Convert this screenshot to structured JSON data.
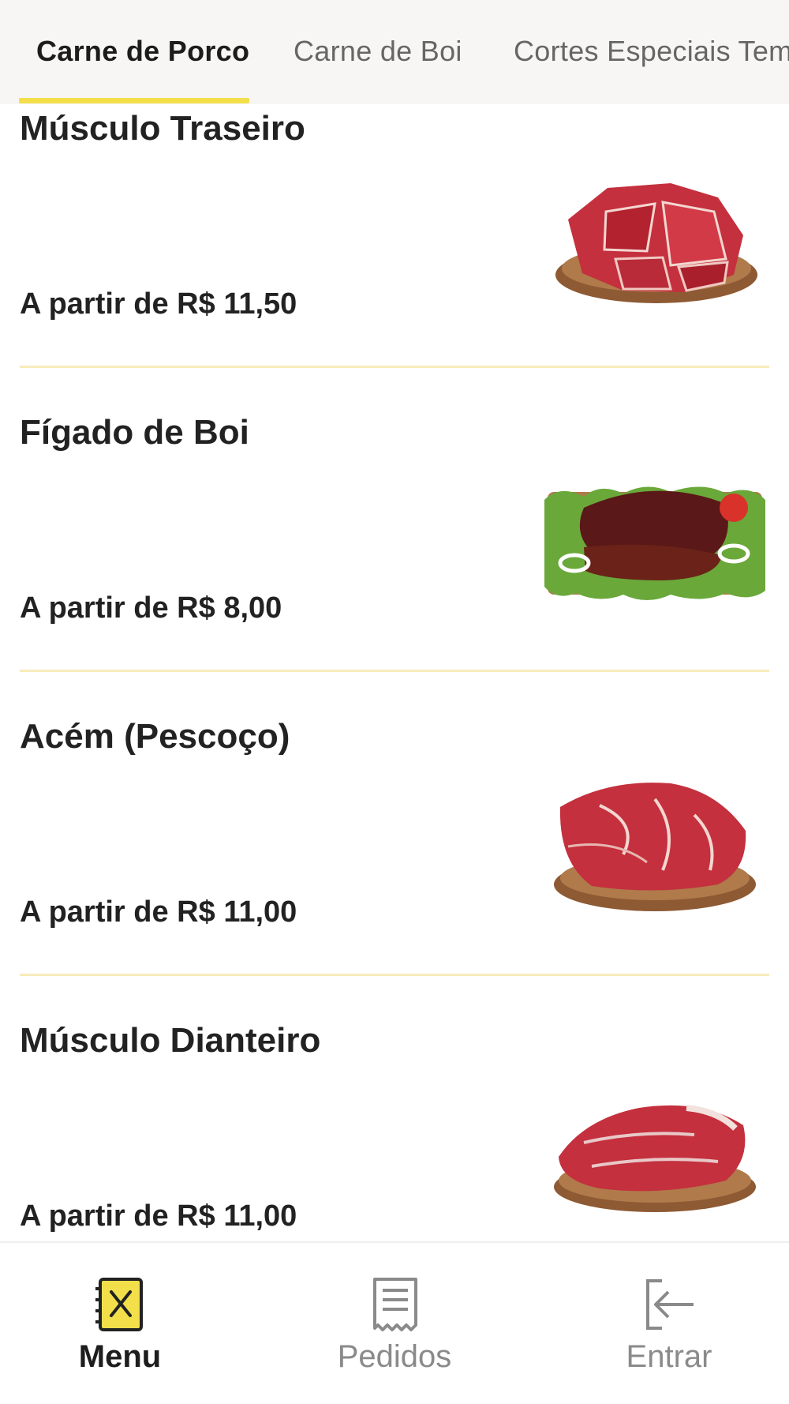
{
  "tabs": [
    {
      "label": "Carne de Porco",
      "active": true
    },
    {
      "label": "Carne de Boi",
      "active": false
    },
    {
      "label": "Cortes Especiais Tem",
      "active": false
    }
  ],
  "products": [
    {
      "name": "Músculo Traseiro",
      "price": "A partir de R$ 11,50",
      "image": "raw-beef-cubes-on-plate"
    },
    {
      "name": "Fígado de Boi",
      "price": "A partir de R$ 8,00",
      "image": "beef-liver-on-board-with-lettuce"
    },
    {
      "name": "Acém (Pescoço)",
      "price": "A partir de R$ 11,00",
      "image": "beef-chuck-on-plate"
    },
    {
      "name": "Músculo Dianteiro",
      "price": "A partir de R$ 11,00",
      "image": "beef-shank-on-plate"
    }
  ],
  "bottom_nav": [
    {
      "label": "Menu",
      "icon": "menu-book-icon",
      "active": true
    },
    {
      "label": "Pedidos",
      "icon": "receipt-icon",
      "active": false
    },
    {
      "label": "Entrar",
      "icon": "login-icon",
      "active": false
    }
  ],
  "colors": {
    "accent": "#f3df4a",
    "divider": "#f6ecbc",
    "text": "#222222",
    "muted": "#8a8a8a",
    "tabbar_bg": "#f7f6f4",
    "meat": "#c4303d"
  }
}
